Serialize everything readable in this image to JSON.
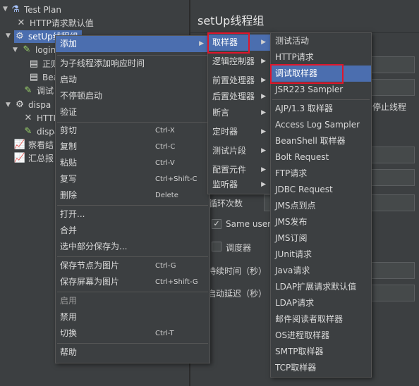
{
  "tree": {
    "nodes": [
      {
        "label": "Test Plan",
        "icon": "flask-icon"
      },
      {
        "label": "HTTP请求默认值",
        "icon": "wrench-icon"
      },
      {
        "label": "setUp线程组",
        "icon": "gear-icon"
      },
      {
        "label": "login",
        "icon": "controller-icon"
      },
      {
        "label": "正则",
        "icon": "script-icon"
      },
      {
        "label": "Bea",
        "icon": "script-icon"
      },
      {
        "label": "调试",
        "icon": "pen-icon"
      },
      {
        "label": "dispa",
        "icon": "gear-icon"
      },
      {
        "label": "HTTP",
        "icon": "wrench-icon"
      },
      {
        "label": "dispa",
        "icon": "pen-icon"
      },
      {
        "label": "察看结",
        "icon": "chart-icon"
      },
      {
        "label": "汇总报",
        "icon": "chart-icon"
      }
    ]
  },
  "panel": {
    "title": "setUp线程组",
    "on_error_stop": "停止线程",
    "loop_count_label": "循环次数",
    "same_user_label": "Same user",
    "delay_label": "调度器",
    "duration_label": "持续时间（秒）",
    "startup_delay_label": "启动延迟（秒）"
  },
  "context_menu": {
    "items": [
      {
        "label": "添加",
        "shortcut": "",
        "submenu": true,
        "highlighted": true
      },
      {
        "label": "为子线程添加响应时间",
        "shortcut": ""
      },
      {
        "label": "启动",
        "shortcut": ""
      },
      {
        "label": "不停顿启动",
        "shortcut": ""
      },
      {
        "label": "验证",
        "shortcut": ""
      },
      {
        "label": "剪切",
        "shortcut": "Ctrl-X"
      },
      {
        "label": "复制",
        "shortcut": "Ctrl-C"
      },
      {
        "label": "粘贴",
        "shortcut": "Ctrl-V"
      },
      {
        "label": "复写",
        "shortcut": "Ctrl+Shift-C"
      },
      {
        "label": "删除",
        "shortcut": "Delete"
      },
      {
        "label": "打开...",
        "shortcut": ""
      },
      {
        "label": "合并",
        "shortcut": ""
      },
      {
        "label": "选中部分保存为...",
        "shortcut": ""
      },
      {
        "label": "保存节点为图片",
        "shortcut": "Ctrl-G"
      },
      {
        "label": "保存屏幕为图片",
        "shortcut": "Ctrl+Shift-G"
      },
      {
        "label": "启用",
        "shortcut": "",
        "disabled": true
      },
      {
        "label": "禁用",
        "shortcut": ""
      },
      {
        "label": "切换",
        "shortcut": "Ctrl-T"
      },
      {
        "label": "帮助",
        "shortcut": ""
      }
    ]
  },
  "add_menu": {
    "items": [
      {
        "label": "取样器",
        "highlighted": true
      },
      {
        "label": "逻辑控制器"
      },
      {
        "label": "前置处理器"
      },
      {
        "label": "后置处理器"
      },
      {
        "label": "断言"
      },
      {
        "label": "定时器"
      },
      {
        "label": "测试片段"
      },
      {
        "label": "配置元件"
      },
      {
        "label": "监听器"
      }
    ]
  },
  "sampler_menu": {
    "items": [
      {
        "label": "测试活动"
      },
      {
        "label": "HTTP请求"
      },
      {
        "label": "调试取样器",
        "highlighted": true
      },
      {
        "label": "JSR223 Sampler"
      },
      {
        "label": "AJP/1.3 取样器"
      },
      {
        "label": "Access Log Sampler"
      },
      {
        "label": "BeanShell 取样器"
      },
      {
        "label": "Bolt Request"
      },
      {
        "label": "FTP请求"
      },
      {
        "label": "JDBC Request"
      },
      {
        "label": "JMS点到点"
      },
      {
        "label": "JMS发布"
      },
      {
        "label": "JMS订阅"
      },
      {
        "label": "JUnit请求"
      },
      {
        "label": "Java请求"
      },
      {
        "label": "LDAP扩展请求默认值"
      },
      {
        "label": "LDAP请求"
      },
      {
        "label": "邮件阅读者取样器"
      },
      {
        "label": "OS进程取样器"
      },
      {
        "label": "SMTP取样器"
      },
      {
        "label": "TCP取样器"
      }
    ]
  },
  "colors": {
    "highlight": "#4b6eaf",
    "annotation": "#e0162b",
    "background": "#3c3f41"
  }
}
